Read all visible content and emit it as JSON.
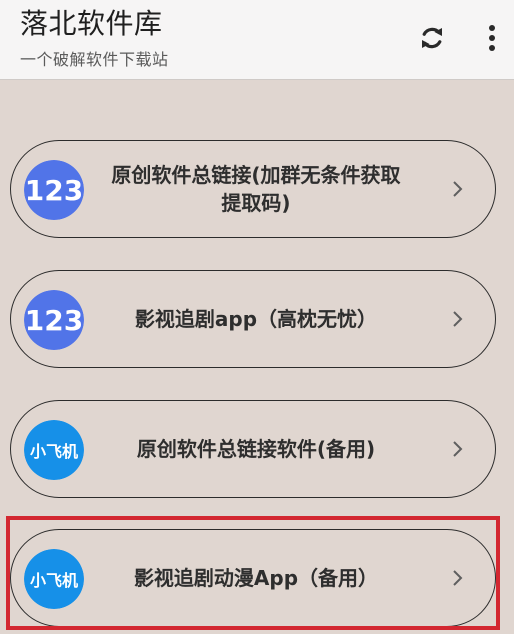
{
  "header": {
    "title": "落北软件库",
    "subtitle": "一个破解软件下载站",
    "refresh_icon": "refresh-icon",
    "more_icon": "more-vertical-icon"
  },
  "items": [
    {
      "label": "原创软件总链接(加群无条件获取提取码)",
      "icon": "app-123-icon",
      "icon_text": "123",
      "chevron": "chevron-right-icon"
    },
    {
      "label": "影视追剧app（高枕无忧）",
      "icon": "app-123-icon",
      "icon_text": "123",
      "chevron": "chevron-right-icon"
    },
    {
      "label": "原创软件总链接软件(备用)",
      "icon": "xiaofeiji-icon",
      "icon_text": "小飞机",
      "chevron": "chevron-right-icon"
    },
    {
      "label": "影视追剧动漫App（备用）",
      "icon": "xiaofeiji-icon",
      "icon_text": "小飞机",
      "chevron": "chevron-right-icon"
    }
  ],
  "colors": {
    "background": "#e0d6d0",
    "header_background": "#f6f5f5",
    "item_border": "#2c2c2c",
    "highlight": "#d32730",
    "icon_123": "#5174e8",
    "icon_xiaofeiji": "#1690e8"
  }
}
